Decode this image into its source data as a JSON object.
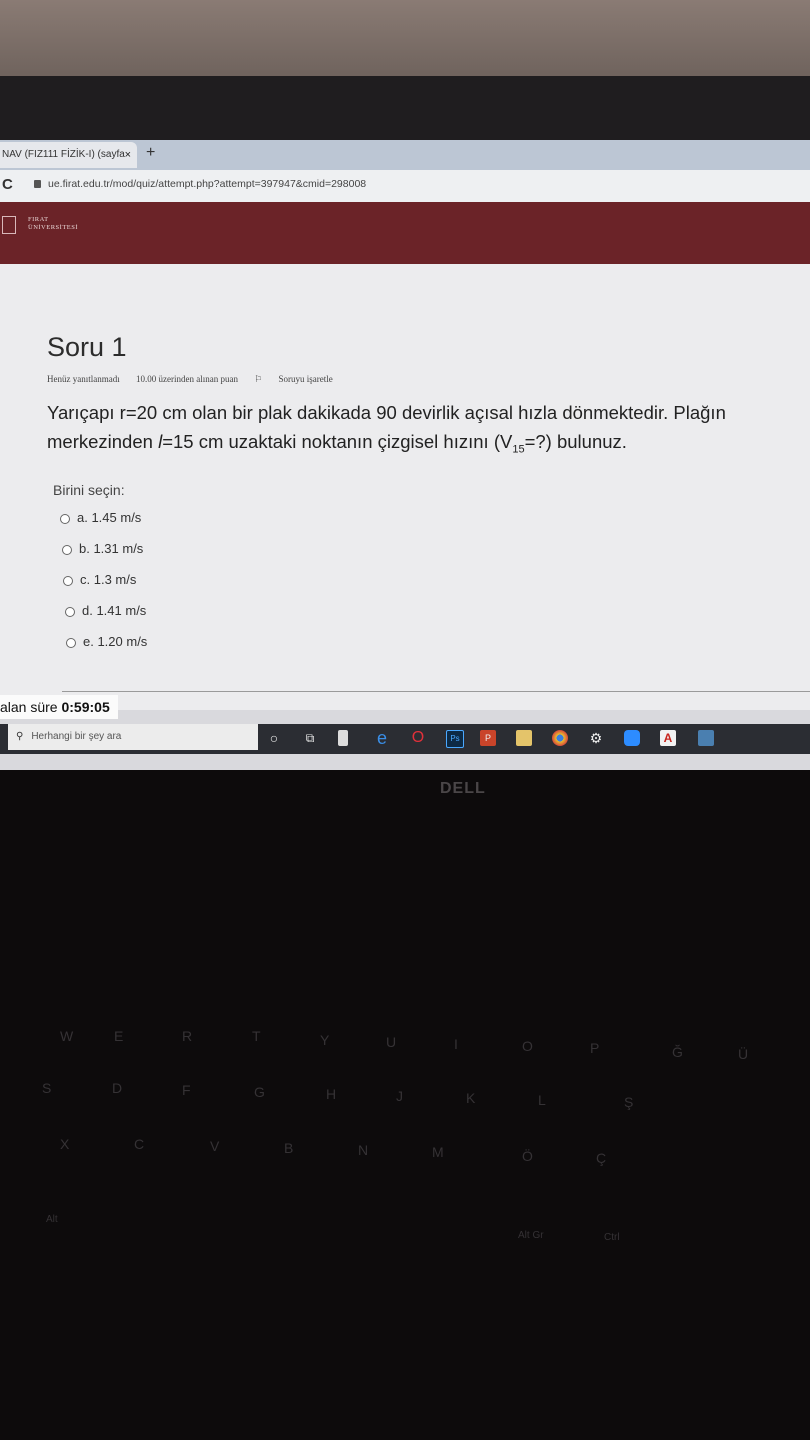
{
  "browser": {
    "tab_title": "NAV (FIZ111 FİZİK-I) (sayfa",
    "tab_close": "×",
    "new_tab": "+",
    "reload": "C",
    "url": "ue.firat.edu.tr/mod/quiz/attempt.php?attempt=397947&cmid=298008"
  },
  "site": {
    "logo_line1": "FIRAT",
    "logo_line2": "ÜNİVERSİTESİ"
  },
  "quiz": {
    "title": "Soru 1",
    "status": "Henüz yanıtlanmadı",
    "points": "10.00 üzerinden alınan puan",
    "flag_label": "Soruyu işaretle",
    "question_line1": "Yarıçapı r=20 cm olan bir plak dakikada 90 devirlik açısal hızla dönmektedir. Plağın",
    "question_line2_a": "merkezinden ",
    "question_l_var": "l",
    "question_line2_b": "=15 cm  uzaktaki noktanın çizgisel hızını (V",
    "question_sub": "15",
    "question_line2_c": "=?) bulunuz.",
    "choose_label": "Birini seçin:",
    "options": [
      {
        "label": "a. 1.45 m/s"
      },
      {
        "label": "b. 1.31 m/s"
      },
      {
        "label": "c. 1.3 m/s"
      },
      {
        "label": "d. 1.41 m/s"
      },
      {
        "label": "e. 1.20 m/s"
      }
    ]
  },
  "timer": {
    "label": "alan süre ",
    "value": "0:59:05"
  },
  "taskbar": {
    "search_placeholder": "Herhangi bir şey ara",
    "icons": [
      "cortana-icon",
      "task-view-icon",
      "file-icon",
      "edge-icon",
      "opera-icon",
      "photoshop-icon",
      "powerpoint-icon",
      "explorer-icon",
      "chrome-icon",
      "settings-icon",
      "zoom-icon",
      "acrobat-icon",
      "calculator-icon"
    ]
  },
  "laptop": {
    "brand": "DELL"
  },
  "keyboard": {
    "row_letters": [
      "W",
      "E",
      "R",
      "T",
      "Y",
      "U",
      "I",
      "O",
      "P",
      "Ğ",
      "Ü"
    ],
    "row_home": [
      "S",
      "D",
      "F",
      "G",
      "H",
      "J",
      "K",
      "L",
      "Ş"
    ],
    "row_bottom": [
      "X",
      "C",
      "V",
      "B",
      "N",
      "M",
      "Ö",
      "Ç"
    ],
    "alt": "Alt",
    "altgr": "Alt Gr",
    "ctrl": "Ctrl"
  }
}
